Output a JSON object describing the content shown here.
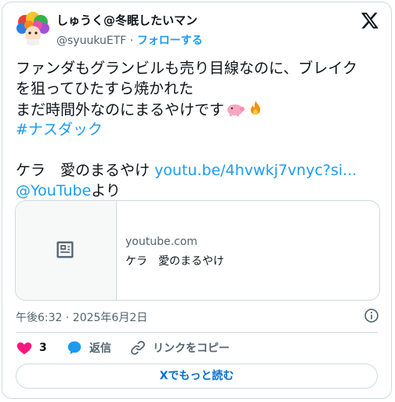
{
  "author": {
    "display_name": "しゅうく@冬眠したいマン",
    "handle": "@syuukuETF",
    "separator": "·",
    "follow_label": "フォローする"
  },
  "tweet": {
    "line1": "ファンダもグランビルも売り目線なのに、ブレイク",
    "line2": "を狙ってひたすら焼かれた",
    "line3": "まだ時間外なのにまるやけです",
    "hashtag": "#ナスダック",
    "song": "ケラ　愛のまるやけ",
    "url": "youtu.be/4hvwkj7vnyc?si...",
    "mention": "@YouTube",
    "mention_suffix": "より"
  },
  "link_card": {
    "domain": "youtube.com",
    "title": "ケラ　愛のまるやけ",
    "thumb_icon": "news-article-icon"
  },
  "meta": {
    "timestamp": "午後6:32 · 2025年6月2日"
  },
  "actions": {
    "like_count": "3",
    "reply_label": "返信",
    "copy_link_label": "リンクをコピー"
  },
  "read_more_label": "Xでもっと読む",
  "colors": {
    "accent": "#1d9bf0",
    "like": "#f91880",
    "text": "#0f1419",
    "muted": "#536471",
    "border": "#cfd9de"
  }
}
